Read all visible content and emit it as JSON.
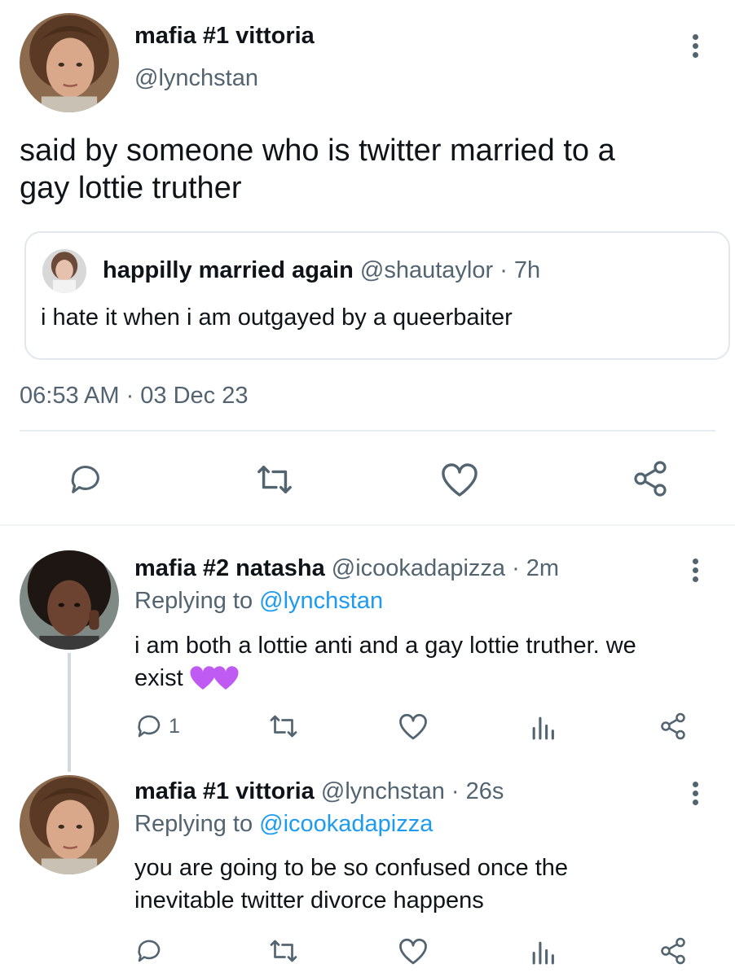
{
  "main_tweet": {
    "display_name": "mafia #1 vittoria",
    "handle": "@lynchstan",
    "text_line1": "said by someone who is twitter married to a",
    "text_line2": "gay lottie truther",
    "timestamp": "06:53 AM · 03 Dec 23",
    "avatar_icon": "avatar-photo",
    "quoted": {
      "display_name": "happilly married again",
      "handle": "@shautaylor",
      "time": "· 7h",
      "text": "i hate it when i am outgayed by a queerbaiter"
    },
    "actions": [
      "reply-icon",
      "retweet-icon",
      "like-icon",
      "share-icon"
    ]
  },
  "replies": [
    {
      "display_name": "mafia #2 natasha",
      "handle": "@icookadapizza",
      "time": "· 2m",
      "replying_prefix": "Replying to",
      "replying_to": "@lynchstan",
      "text_line1": "i am both a lottie anti and a gay lottie truther. we",
      "text_line2": "exist",
      "emoji": "💜💜",
      "reply_count": "1"
    },
    {
      "display_name": "mafia #1 vittoria",
      "handle": "@lynchstan",
      "time": "· 26s",
      "replying_prefix": "Replying to",
      "replying_to": "@icookadapizza",
      "text_line1": "you are going to be so confused once the",
      "text_line2": "inevitable twitter divorce happens",
      "reply_count": ""
    }
  ],
  "colors": {
    "text": "#0f1419",
    "muted": "#536471",
    "link": "#1d9bf0",
    "heart": "#bf5af2",
    "border": "#e1e8ed"
  }
}
